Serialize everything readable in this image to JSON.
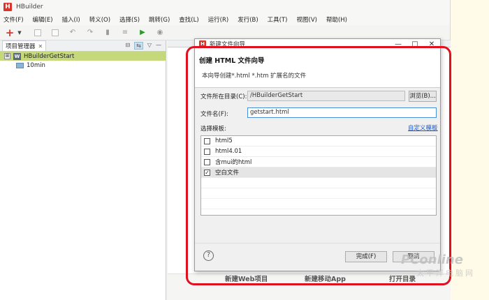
{
  "app": {
    "title": "HBuilder",
    "logo": "H",
    "menu": [
      "文件(F)",
      "编辑(E)",
      "插入(I)",
      "转义(O)",
      "选择(S)",
      "跳转(G)",
      "查找(L)",
      "运行(R)",
      "发行(B)",
      "工具(T)",
      "视图(V)",
      "帮助(H)"
    ]
  },
  "toolbar": {
    "icons": [
      "new-icon",
      "dropdown-arrow-icon",
      "save-icon",
      "save-all-icon",
      "undo-icon",
      "redo-icon",
      "bookmark-icon",
      "format-icon",
      "run-icon",
      "browser-icon"
    ]
  },
  "project_panel": {
    "tab_label": "项目管理器",
    "tab_close": "✕",
    "tree": [
      {
        "label": "HBuilderGetStart",
        "expander": "⊞",
        "badge": "W",
        "selected": true
      },
      {
        "label": "10min",
        "selected": false
      }
    ]
  },
  "editor": {
    "welcome_links": [
      "新建Web项目",
      "新建移动App",
      "打开目录"
    ]
  },
  "dialog": {
    "window_title": "新建文件向导",
    "controls": [
      "—",
      "□",
      "✕"
    ],
    "heading": "创建 HTML 文件向导",
    "subtitle": "本向导创建*.html *.htm 扩展名的文件",
    "dir_label": "文件所在目录(C):",
    "dir_value": "/HBuilderGetStart",
    "browse_label": "浏览(B)...",
    "name_label": "文件名(F):",
    "name_value": "getstart.html",
    "template_label": "选择模板:",
    "custom_template_link": "自定义模板",
    "templates": [
      {
        "label": "html5",
        "checked": false
      },
      {
        "label": "html4.01",
        "checked": false
      },
      {
        "label": "含mui的html",
        "checked": false
      },
      {
        "label": "空白文件",
        "checked": true
      }
    ],
    "check_mark": "✓",
    "help_icon": "?",
    "finish_label": "完成(F)",
    "cancel_label": "取消"
  },
  "watermark": {
    "brand": "PConline",
    "cn": "太平洋电脑网"
  },
  "colors": {
    "brand_red": "#d9352b",
    "selection_green": "#c5d97c",
    "annotation_red": "#e0101e",
    "link_blue": "#1a56c8"
  }
}
